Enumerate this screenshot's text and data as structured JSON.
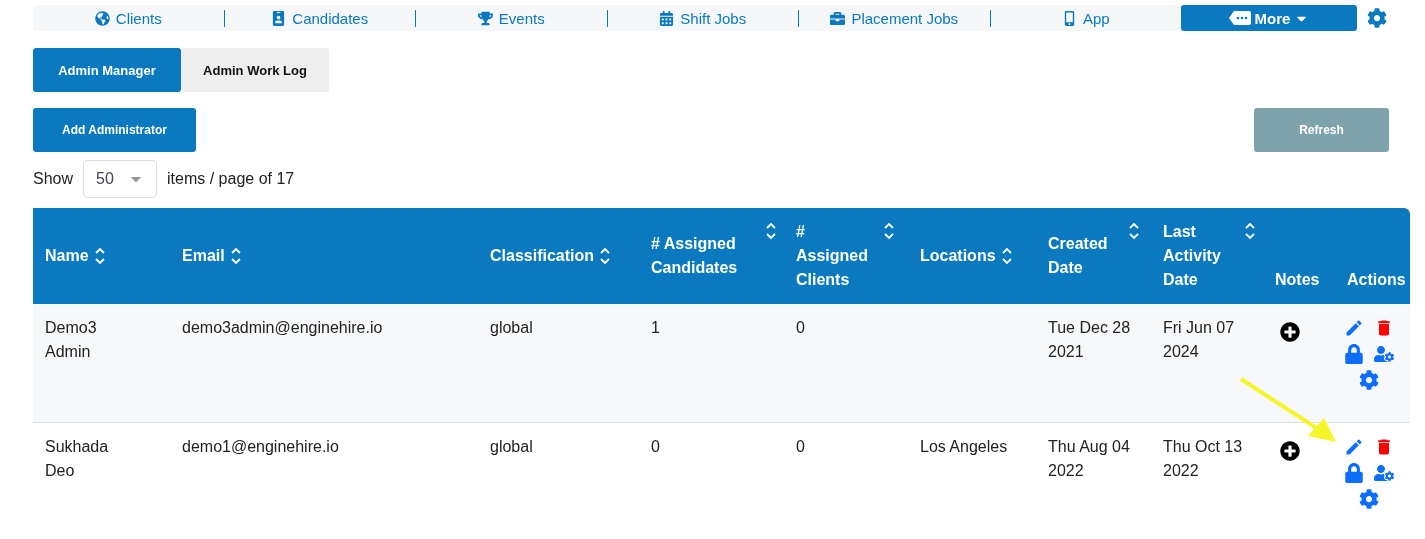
{
  "nav": {
    "items": [
      {
        "label": "Clients"
      },
      {
        "label": "Candidates"
      },
      {
        "label": "Events"
      },
      {
        "label": "Shift Jobs"
      },
      {
        "label": "Placement Jobs"
      },
      {
        "label": "App"
      }
    ],
    "more": "More"
  },
  "tabs": [
    {
      "label": "Admin Manager",
      "selected": true
    },
    {
      "label": "Admin Work Log",
      "selected": false
    }
  ],
  "add_button": "Add Administrator",
  "refresh_button": "Refresh",
  "pager": {
    "show": "Show",
    "page_size": "50",
    "suffix": "items / page of 17"
  },
  "table": {
    "columns": [
      {
        "label": "Name",
        "sortable": true
      },
      {
        "label": "Email",
        "sortable": true
      },
      {
        "label": "Classification",
        "sortable": true
      },
      {
        "label": "# Assigned Candidates",
        "sortable": true
      },
      {
        "label": "# Assigned Clients",
        "sortable": true
      },
      {
        "label": "Locations",
        "sortable": true
      },
      {
        "label": "Created Date",
        "sortable": true
      },
      {
        "label": "Last Activity Date",
        "sortable": true
      },
      {
        "label": "Notes",
        "sortable": false
      },
      {
        "label": "Actions",
        "sortable": false
      }
    ],
    "rows": [
      {
        "cells": [
          "Demo3 Admin",
          "demo3admin@enginehire.io",
          "global",
          "1",
          "0",
          "",
          "Tue Dec 28 2021",
          "Fri Jun 07 2024"
        ]
      },
      {
        "cells": [
          "Sukhada Deo",
          "demo1@enginehire.io",
          "global",
          "0",
          "0",
          "Los Angeles",
          "Thu Aug 04 2022",
          "Thu Oct 13 2022"
        ]
      }
    ]
  }
}
